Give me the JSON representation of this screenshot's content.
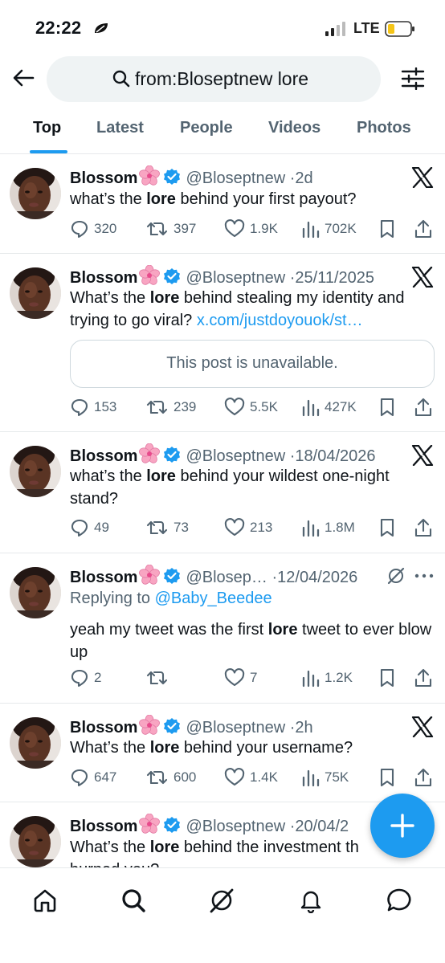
{
  "status_bar": {
    "time": "22:22",
    "network": "LTE"
  },
  "search": {
    "query": "from:Bloseptnew lore"
  },
  "tabs": [
    {
      "label": "Top",
      "active": true
    },
    {
      "label": "Latest",
      "active": false
    },
    {
      "label": "People",
      "active": false
    },
    {
      "label": "Videos",
      "active": false
    },
    {
      "label": "Photos",
      "active": false
    }
  ],
  "tweets": [
    {
      "name": "Blossom",
      "handle": "@Bloseptnew",
      "separator": "·",
      "time": "2d",
      "text_before": "what’s the ",
      "text_bold": "lore",
      "text_after": " behind your first payout?",
      "replies": "320",
      "reposts": "397",
      "likes": "1.9K",
      "views": "702K"
    },
    {
      "name": "Blossom",
      "handle": "@Bloseptnew",
      "separator": "·",
      "time": "25/11/2025",
      "text_before": "What’s the ",
      "text_bold": "lore",
      "text_after": " behind stealing my identity and trying to go viral? ",
      "link": "x.com/justdoyouok/st…",
      "quote_text": "This post is unavailable.",
      "replies": "153",
      "reposts": "239",
      "likes": "5.5K",
      "views": "427K"
    },
    {
      "name": "Blossom",
      "handle": "@Bloseptnew",
      "separator": "·",
      "time": "18/04/2026",
      "text_before": "what’s the ",
      "text_bold": "lore",
      "text_after": " behind your wildest one-night stand?",
      "replies": "49",
      "reposts": "73",
      "likes": "213",
      "views": "1.8M"
    },
    {
      "name": "Blossom",
      "handle": "@Blosep…",
      "separator": "·",
      "time": "12/04/2026",
      "replying_prefix": "Replying to ",
      "replying_to": "@Baby_Beedee",
      "text_before": "yeah my tweet was the first ",
      "text_bold": "lore",
      "text_after": " tweet to ever blow up",
      "replies": "2",
      "reposts": "",
      "likes": "7",
      "views": "1.2K"
    },
    {
      "name": "Blossom",
      "handle": "@Bloseptnew",
      "separator": "·",
      "time": "2h",
      "text_before": "What’s the ",
      "text_bold": "lore",
      "text_after": " behind your username?",
      "replies": "647",
      "reposts": "600",
      "likes": "1.4K",
      "views": "75K"
    },
    {
      "name": "Blossom",
      "handle": "@Bloseptnew",
      "separator": "·",
      "time": "20/04/2",
      "text_before": "What’s the ",
      "text_bold": "lore",
      "text_after": " behind the investment th",
      "text_line2": "burned you?"
    }
  ],
  "colors": {
    "accent": "#1d9bf0",
    "text": "#0f1419",
    "muted": "#536471",
    "border": "#e6e9eb"
  },
  "icons": [
    "back-arrow-icon",
    "search-icon",
    "filter-icon",
    "x-logo-icon",
    "grok-icon",
    "more-icon",
    "reply-icon",
    "repost-icon",
    "like-icon",
    "views-icon",
    "bookmark-icon",
    "share-icon",
    "home-icon",
    "explore-icon",
    "notifications-icon",
    "messages-icon",
    "compose-icon"
  ]
}
